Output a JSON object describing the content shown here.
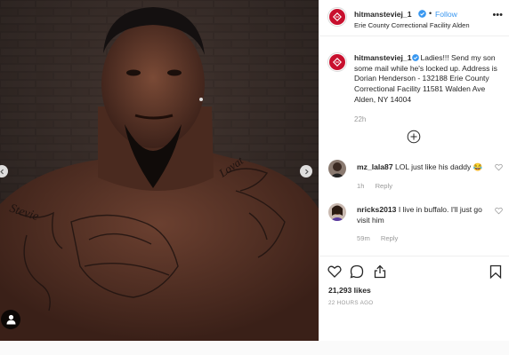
{
  "post": {
    "author": {
      "username": "hitmansteviej_1",
      "verified": true,
      "follow_label": "Follow",
      "location": "Erie County Correctional Facility Alden"
    },
    "caption": {
      "username": "hitmansteviej_1",
      "text": "Ladies!!! Send my son some mail while he's locked up. Address is Dorian Henderson - 132188 Erie County Correctional Facility 11581 Walden Ave Alden, NY 14004",
      "time": "22h"
    },
    "comments": [
      {
        "username": "mz_lala87",
        "text": "LOL just like his daddy",
        "emoji": "😂",
        "time": "1h",
        "reply_label": "Reply"
      },
      {
        "username": "nricks2013",
        "text": "I live in buffalo. I'll just go visit him",
        "time": "59m",
        "reply_label": "Reply"
      }
    ],
    "likes": "21,293 likes",
    "posted_ago": "22 HOURS AGO"
  },
  "colors": {
    "link_blue": "#3897f0",
    "brand_red": "#c8102e",
    "text": "#262626",
    "muted": "#999999"
  },
  "icons": [
    "chevron-left-icon",
    "chevron-right-icon",
    "user-tag-icon",
    "verified-badge-icon",
    "more-options-icon",
    "load-more-comments-icon",
    "heart-icon",
    "comment-icon",
    "share-icon",
    "bookmark-icon"
  ]
}
